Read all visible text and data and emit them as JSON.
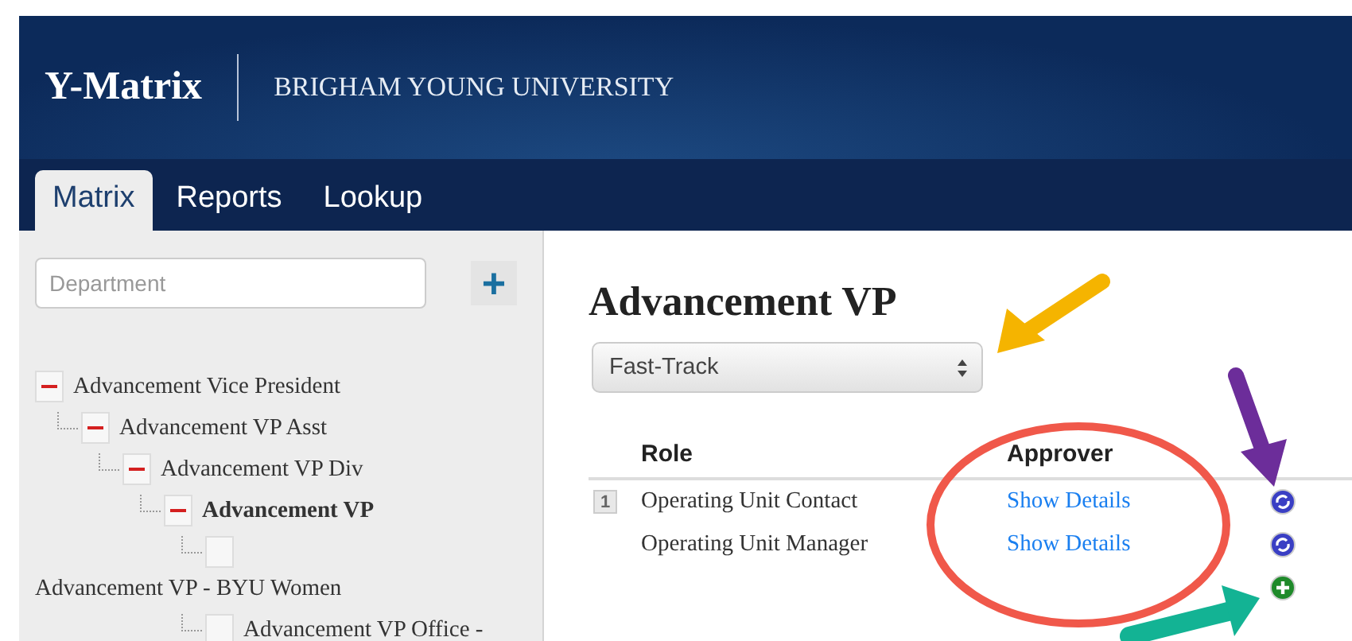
{
  "header": {
    "app_name": "Y-Matrix",
    "organization": "BRIGHAM YOUNG UNIVERSITY"
  },
  "tabs": [
    {
      "label": "Matrix",
      "selected": true
    },
    {
      "label": "Reports",
      "selected": false
    },
    {
      "label": "Lookup",
      "selected": false
    }
  ],
  "sidebar": {
    "search": {
      "placeholder": "Department"
    },
    "add_button": "+",
    "tree": [
      {
        "label": "Advancement Vice President",
        "expanded": true,
        "selected": false,
        "children": [
          {
            "label": "Advancement VP Asst",
            "expanded": true,
            "selected": false,
            "children": [
              {
                "label": "Advancement VP Div",
                "expanded": true,
                "selected": false,
                "children": [
                  {
                    "label": "Advancement VP",
                    "expanded": true,
                    "selected": true,
                    "children": [
                      {
                        "label": "Advancement VP - BYU Women",
                        "expanded": false,
                        "selected": false
                      },
                      {
                        "label": "Advancement VP Office -",
                        "expanded": false,
                        "selected": false
                      }
                    ]
                  }
                ]
              }
            ]
          }
        ]
      }
    ]
  },
  "main": {
    "title": "Advancement VP",
    "track_select": {
      "value": "Fast-Track"
    },
    "table": {
      "columns": [
        "Role",
        "Approver"
      ],
      "rows": [
        {
          "number": "1",
          "role": "Operating Unit Contact",
          "approver": "Show Details"
        },
        {
          "role": "Operating Unit Manager",
          "approver": "Show Details"
        }
      ]
    }
  }
}
